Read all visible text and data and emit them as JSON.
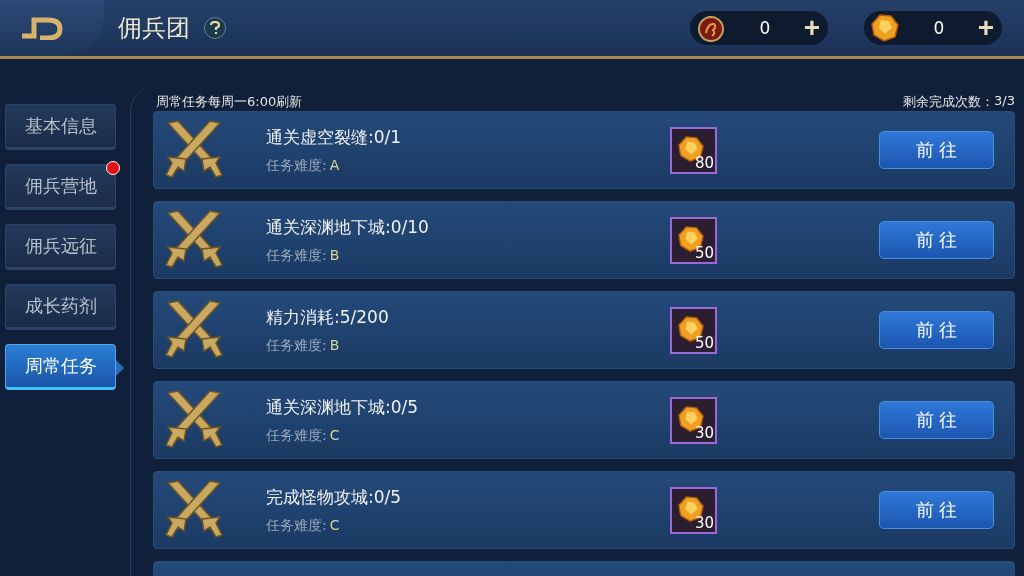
{
  "header": {
    "title": "佣兵团",
    "currencies": [
      {
        "kind": "medal",
        "amount": "0",
        "add": "+"
      },
      {
        "kind": "gem",
        "amount": "0",
        "add": "+"
      }
    ]
  },
  "sidebar": {
    "items": [
      {
        "label": "基本信息",
        "selected": false,
        "alert": false
      },
      {
        "label": "佣兵营地",
        "selected": false,
        "alert": true
      },
      {
        "label": "佣兵远征",
        "selected": false,
        "alert": false
      },
      {
        "label": "成长药剂",
        "selected": false,
        "alert": false
      },
      {
        "label": "周常任务",
        "selected": true,
        "alert": false
      }
    ]
  },
  "panel": {
    "notice": "周常任务每周一6:00刷新",
    "remaining_label": "剩余完成次数：",
    "remaining": "3/3"
  },
  "tasks": [
    {
      "kind": "task",
      "title": "通关虚空裂缝:0/1",
      "difficulty_label": "任务难度:",
      "difficulty": "A",
      "reward": "80",
      "button": "前 往"
    },
    {
      "kind": "task",
      "title": "通关深渊地下城:0/10",
      "difficulty_label": "任务难度:",
      "difficulty": "B",
      "reward": "50",
      "button": "前 往"
    },
    {
      "kind": "task",
      "title": "精力消耗:5/200",
      "difficulty_label": "任务难度:",
      "difficulty": "B",
      "reward": "50",
      "button": "前 往"
    },
    {
      "kind": "task",
      "title": "通关深渊地下城:0/5",
      "difficulty_label": "任务难度:",
      "difficulty": "C",
      "reward": "30",
      "button": "前 往"
    },
    {
      "kind": "task",
      "title": "完成怪物攻城:0/5",
      "difficulty_label": "任务难度:",
      "difficulty": "C",
      "reward": "30",
      "button": "前 往"
    },
    {
      "kind": "partial"
    }
  ]
}
